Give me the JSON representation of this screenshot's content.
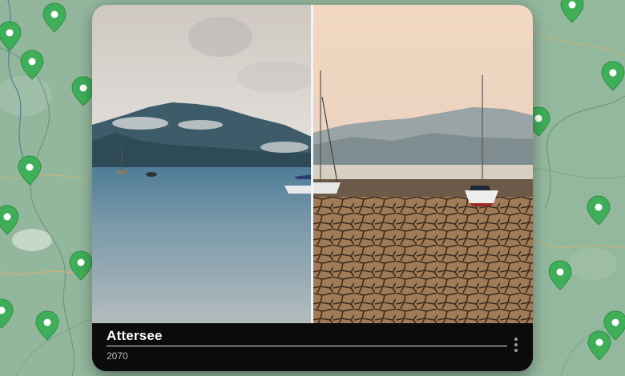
{
  "caption": {
    "title": "Attersee",
    "year": "2070"
  },
  "icons": {
    "map_pin": "map-pin-icon",
    "more": "more-vertical-icon"
  },
  "colors": {
    "map_background": "#8fb39a",
    "pin": "#3fae58",
    "card_footer": "#0b0b0b"
  }
}
